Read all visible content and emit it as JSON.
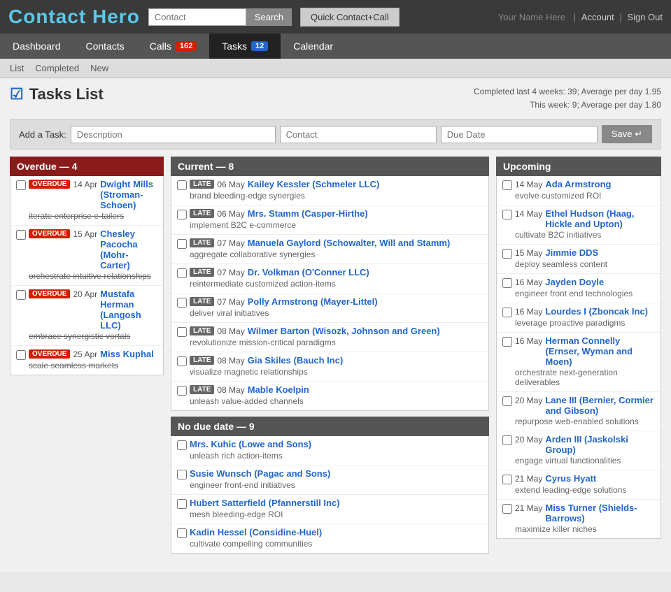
{
  "header": {
    "logo_text1": "Contact",
    "logo_text2": "Hero",
    "search_placeholder": "Contact",
    "search_btn": "Search",
    "quick_contact_btn": "Quick Contact+Call",
    "user_name": "Your Name Here",
    "account_link": "Account",
    "signout_link": "Sign Out"
  },
  "nav": {
    "tabs": [
      {
        "label": "Dashboard",
        "badge": null,
        "active": false
      },
      {
        "label": "Contacts",
        "badge": null,
        "active": false
      },
      {
        "label": "Calls",
        "badge": "162",
        "badge_color": "red",
        "active": false
      },
      {
        "label": "Tasks",
        "badge": "12",
        "badge_color": "blue",
        "active": true
      },
      {
        "label": "Calendar",
        "badge": null,
        "active": false
      }
    ],
    "sub_links": [
      "List",
      "Completed",
      "New"
    ]
  },
  "tasks": {
    "title": "Tasks List",
    "stats_line1": "Completed last 4 weeks: 39; Average per day 1.95",
    "stats_line2": "This week: 9; Average per day 1.80",
    "add_label": "Add a Task:",
    "add_desc_placeholder": "Description",
    "add_contact_placeholder": "Contact",
    "add_date_placeholder": "Due Date",
    "add_save_btn": "Save ↵"
  },
  "overdue": {
    "header": "Overdue — 4",
    "items": [
      {
        "badge": "OVERDUE",
        "date": "14 Apr",
        "contact": "Dwight Mills (Stroman-Schoen)",
        "desc": "iterate enterprise e-tailers"
      },
      {
        "badge": "OVERDUE",
        "date": "15 Apr",
        "contact": "Chesley Pacocha (Mohr-Carter)",
        "desc": "orchestrate intuitive relationships"
      },
      {
        "badge": "OVERDUE",
        "date": "20 Apr",
        "contact": "Mustafa Herman (Langosh LLC)",
        "desc": "embrace synergistic vortals"
      },
      {
        "badge": "OVERDUE",
        "date": "25 Apr",
        "contact": "Miss Kuphal",
        "desc": "scale seamless markets"
      }
    ]
  },
  "current": {
    "header": "Current — 8",
    "items": [
      {
        "badge": "LATE",
        "date": "06 May",
        "contact": "Kailey Kessler (Schmeler LLC)",
        "desc": "brand bleeding-edge synergies"
      },
      {
        "badge": "LATE",
        "date": "06 May",
        "contact": "Mrs. Stamm (Casper-Hirthe)",
        "desc": "implement B2C e-commerce"
      },
      {
        "badge": "LATE",
        "date": "07 May",
        "contact": "Manuela Gaylord (Schowalter, Will and Stamm)",
        "desc": "aggregate collaborative synergies"
      },
      {
        "badge": "LATE",
        "date": "07 May",
        "contact": "Dr. Volkman (O'Conner LLC)",
        "desc": "reintermediate customized action-items"
      },
      {
        "badge": "LATE",
        "date": "07 May",
        "contact": "Polly Armstrong (Mayer-Littel)",
        "desc": "deliver viral initiatives"
      },
      {
        "badge": "LATE",
        "date": "08 May",
        "contact": "Wilmer Barton (Wisozk, Johnson and Green)",
        "desc": "revolutionize mission-critical paradigms"
      },
      {
        "badge": "LATE",
        "date": "08 May",
        "contact": "Gia Skiles (Bauch Inc)",
        "desc": "visualize magnetic relationships"
      },
      {
        "badge": "LATE",
        "date": "08 May",
        "contact": "Mable Koelpin",
        "desc": "unleash value-added channels"
      }
    ]
  },
  "nodue": {
    "header": "No due date — 9",
    "items": [
      {
        "contact": "Mrs. Kuhic (Lowe and Sons)",
        "desc": "unleash rich action-items"
      },
      {
        "contact": "Susie Wunsch (Pagac and Sons)",
        "desc": "engineer front-end initiatives"
      },
      {
        "contact": "Hubert Satterfield (Pfannerstill Inc)",
        "desc": "mesh bleeding-edge ROI"
      },
      {
        "contact": "Kadin Hessel (Considine-Huel)",
        "desc": "cultivate compelling communities"
      }
    ]
  },
  "upcoming": {
    "header": "Upcoming",
    "items": [
      {
        "date": "14 May",
        "contact": "Ada Armstrong",
        "desc": "evolve customized ROI"
      },
      {
        "date": "14 May",
        "contact": "Ethel Hudson (Haag, Hickle and Upton)",
        "desc": "cultivate B2C initiatives"
      },
      {
        "date": "15 May",
        "contact": "Jimmie DDS",
        "desc": "deploy seamless content"
      },
      {
        "date": "16 May",
        "contact": "Jayden Doyle",
        "desc": "engineer front end technologies"
      },
      {
        "date": "16 May",
        "contact": "Lourdes I (Zboncak Inc)",
        "desc": "leverage proactive paradigms"
      },
      {
        "date": "16 May",
        "contact": "Herman Connelly (Ernser, Wyman and Moen)",
        "desc": "orchestrate next-generation deliverables"
      },
      {
        "date": "20 May",
        "contact": "Lane III (Bernier, Cormier and Gibson)",
        "desc": "repurpose web-enabled solutions"
      },
      {
        "date": "20 May",
        "contact": "Arden III (Jaskolski Group)",
        "desc": "engage virtual functionalities"
      },
      {
        "date": "21 May",
        "contact": "Cyrus Hyatt",
        "desc": "extend leading-edge solutions"
      },
      {
        "date": "21 May",
        "contact": "Miss Turner (Shields-Barrows)",
        "desc": "maximize killer niches"
      }
    ]
  }
}
